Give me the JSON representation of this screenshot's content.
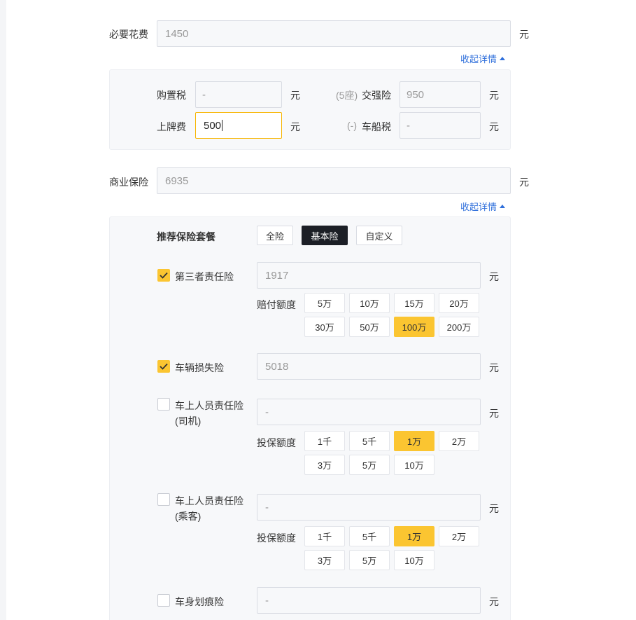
{
  "required_cost": {
    "label": "必要花费",
    "value": "1450",
    "unit": "元"
  },
  "collapse_link_1": "收起详情",
  "details": {
    "purchase_tax": {
      "label": "购置税",
      "value": "-",
      "unit": "元"
    },
    "compulsory": {
      "prefix": "(5座)",
      "label": "交强险",
      "value": "950",
      "unit": "元"
    },
    "license_fee": {
      "label": "上牌费",
      "value": "500",
      "unit": "元"
    },
    "vehicle_tax": {
      "prefix": "(-)",
      "label": "车船税",
      "value": "-",
      "unit": "元"
    }
  },
  "commercial": {
    "label": "商业保险",
    "value": "6935",
    "unit": "元"
  },
  "collapse_link_2": "收起详情",
  "package": {
    "label": "推荐保险套餐",
    "options": [
      "全险",
      "基本险",
      "自定义"
    ],
    "selected": "基本险"
  },
  "insurances": {
    "third_party": {
      "label": "第三者责任险",
      "checked": true,
      "value": "1917",
      "unit": "元",
      "amount_label": "赔付额度",
      "options": [
        "5万",
        "10万",
        "15万",
        "20万",
        "30万",
        "50万",
        "100万",
        "200万"
      ],
      "selected": "100万"
    },
    "vehicle_loss": {
      "label": "车辆损失险",
      "checked": true,
      "value": "5018",
      "unit": "元"
    },
    "driver": {
      "label_line1": "车上人员责任险",
      "label_line2": "(司机)",
      "checked": false,
      "value": "-",
      "unit": "元",
      "amount_label": "投保额度",
      "options": [
        "1千",
        "5千",
        "1万",
        "2万",
        "3万",
        "5万",
        "10万"
      ],
      "selected": "1万"
    },
    "passenger": {
      "label_line1": "车上人员责任险",
      "label_line2": "(乘客)",
      "checked": false,
      "value": "-",
      "unit": "元",
      "amount_label": "投保额度",
      "options": [
        "1千",
        "5千",
        "1万",
        "2万",
        "3万",
        "5万",
        "10万"
      ],
      "selected": "1万"
    },
    "scratch": {
      "label": "车身划痕险",
      "checked": false,
      "value": "-",
      "unit": "元"
    }
  },
  "icons": {
    "check": "check-icon",
    "collapse": "triangle-up-icon"
  },
  "colors": {
    "accent": "#fbc531",
    "link": "#2f6fdb",
    "dark": "#1c1f26"
  }
}
